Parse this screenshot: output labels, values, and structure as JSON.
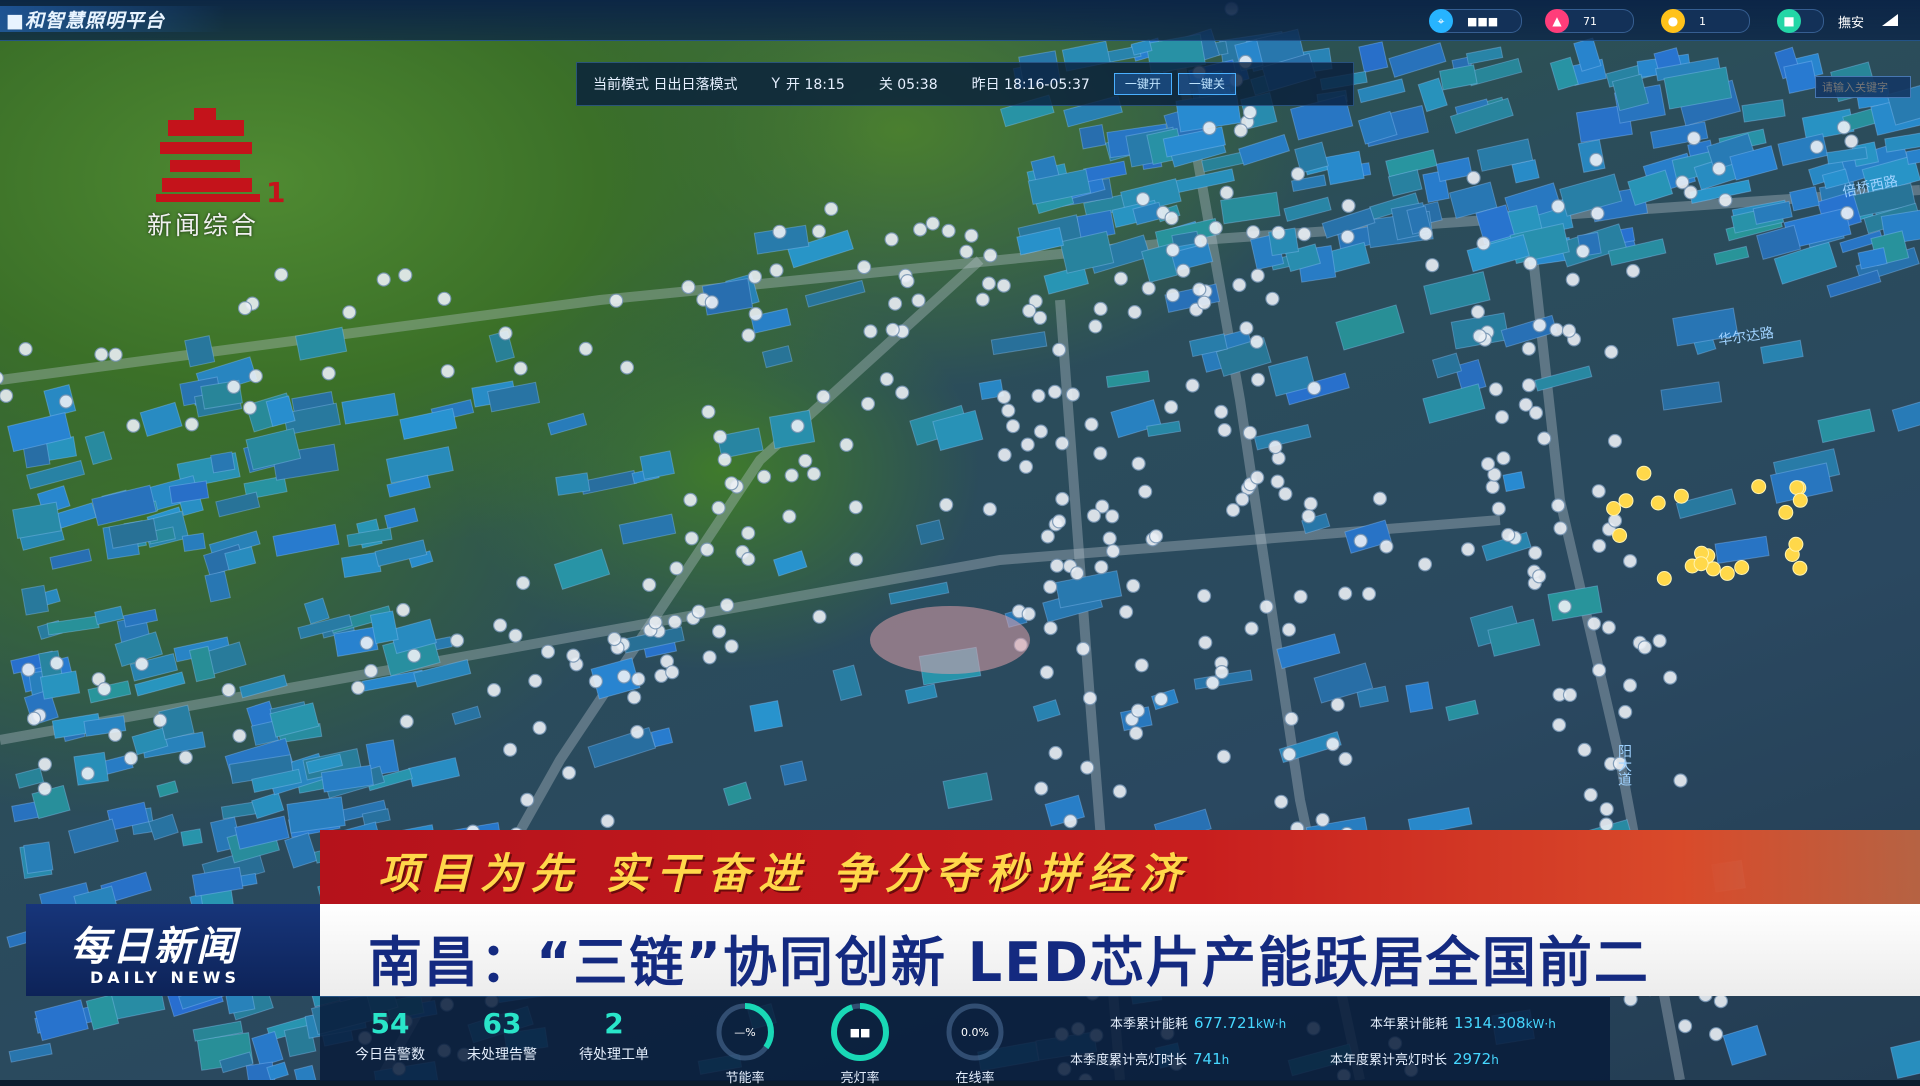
{
  "platform": {
    "title": "■和智慧照明平台"
  },
  "top_stats": [
    {
      "icon": "location-pin-icon",
      "color": "#27b4ff",
      "value": "■■■"
    },
    {
      "icon": "alarm-icon",
      "color": "#ff3d7a",
      "value": "71"
    },
    {
      "icon": "bulb-icon",
      "color": "#ffc21a",
      "value": "1"
    },
    {
      "icon": "status-icon",
      "color": "#23d6a6",
      "value": ""
    }
  ],
  "user": {
    "name": "撫安"
  },
  "mode_panel": {
    "mode": "当前模式 日出日落模式",
    "on_time": "开 18:15",
    "off_time": "关 05:38",
    "yesterday": "昨日 18:16-05:37",
    "open_all": "一键开",
    "close_all": "一键关"
  },
  "search": {
    "placeholder": "请输入关键字"
  },
  "channel": {
    "number": "1",
    "name": "新闻综合"
  },
  "news": {
    "slogan": "项目为先  实干奋进  争分夺秒拼经济",
    "program_cn": "每日新闻",
    "program_en": "DAILY NEWS",
    "headline": "南昌：“三链”协同创新 LED芯片产能跃居全国前二"
  },
  "bottom_stats": {
    "kpis": [
      {
        "value": "54",
        "label": "今日告警数"
      },
      {
        "value": "63",
        "label": "未处理告警"
      },
      {
        "value": "2",
        "label": "待处理工单"
      }
    ],
    "gauges": [
      {
        "label": "节能率",
        "value_text": "—%",
        "fraction": 0.35,
        "color": "#19d8b6"
      },
      {
        "label": "亮灯率",
        "value_text": "■■",
        "fraction": 0.95,
        "color": "#19d8b6"
      },
      {
        "label": "在线率",
        "value_text": "0.0%",
        "fraction": 0.0,
        "color": "#19d8b6"
      }
    ],
    "energy": {
      "season_kwh_label": "本季累计能耗",
      "season_kwh_value": "677.721",
      "season_kwh_unit": "kW·h",
      "year_kwh_label": "本年累计能耗",
      "year_kwh_value": "1314.308",
      "year_kwh_unit": "kW·h",
      "season_hours_label": "本季度累计亮灯时长",
      "season_hours_value": "741",
      "season_hours_unit": "h",
      "year_hours_label": "本年度累计亮灯时长",
      "year_hours_value": "2972",
      "year_hours_unit": "h"
    }
  },
  "map_labels": [
    "倍桥西路",
    "华尔达路",
    "阳大道"
  ]
}
